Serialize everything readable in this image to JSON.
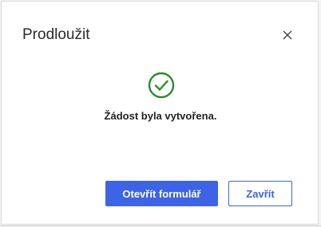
{
  "dialog": {
    "title": "Prodloužit",
    "close_icon": "close-icon",
    "status_icon": "check-circle-icon",
    "message": "Žádost byla vytvořena.",
    "buttons": {
      "open_form_label": "Otevřít formulář",
      "close_label": "Zavřít"
    }
  },
  "colors": {
    "accent": "#3d63e6",
    "success": "#2e8b2e",
    "text": "#222222"
  }
}
